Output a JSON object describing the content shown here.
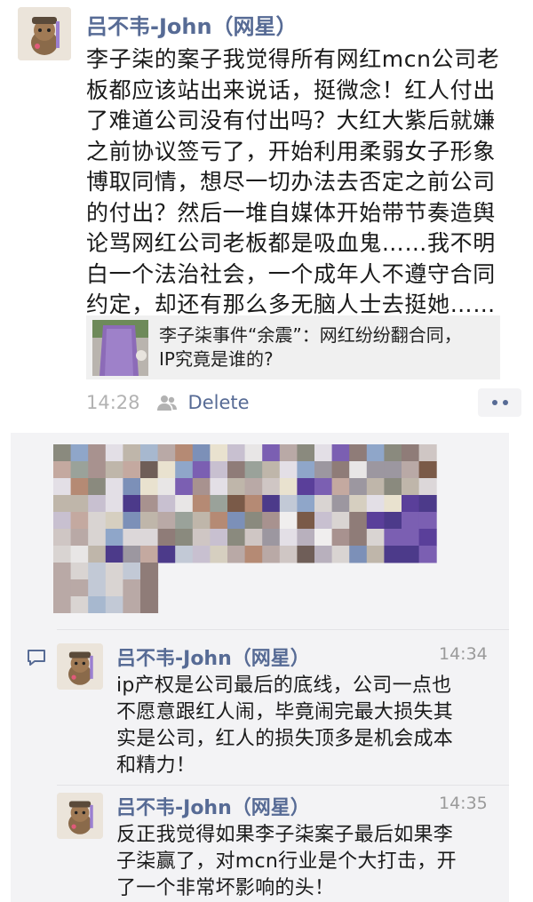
{
  "post": {
    "author": "吕不韦-John（网星）",
    "text_lines": [
      "李子柒的案子我觉得所有网红mcn公司老",
      "板都应该站出来说话，挺微念！红人付出",
      "了难道公司没有付出吗？大红大紫后就嫌",
      "之前协议签亏了，开始利用柔弱女子形象",
      "博取同情，想尽一切办法去否定之前公司",
      "的付出？然后一堆自媒体开始带节奏造舆",
      "论骂网红公司老板都是吸血鬼……我不明",
      "白一个法治社会，一个成年人不遵守合同",
      "约定，却还有那么多无脑人士去挺她……"
    ],
    "link": {
      "title_lines": [
        "李子柒事件“余震”：网红纷纷翻合同，",
        "IP究竟是谁的?"
      ]
    },
    "time": "14:28",
    "delete_label": "Delete"
  },
  "comments": [
    {
      "author": "吕不韦-John（网星）",
      "time": "14:34",
      "text_lines": [
        "ip产权是公司最后的底线，公司一点也",
        "不愿意跟红人闹，毕竟闹完最大损失其",
        "实是公司，红人的损失顶多是机会成本",
        "和精力！"
      ]
    },
    {
      "author": "吕不韦-John（网星）",
      "time": "14:35",
      "text_lines": [
        "反正我觉得如果李子柒案子最后如果李",
        "子柒赢了，对mcn行业是个大打击，开",
        "了一个非常坏影响的头！"
      ]
    }
  ],
  "colors": {
    "link": "#576b95",
    "meta": "#b2b2b2",
    "panel": "#f3f3f5"
  }
}
